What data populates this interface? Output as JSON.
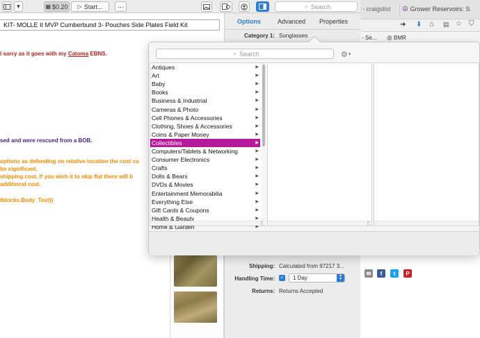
{
  "toolbar": {
    "price": "$0.20",
    "start_label": "Start...",
    "more": "···",
    "search_placeholder": "Search"
  },
  "browser": {
    "tab_partial": "- craigslist",
    "tab2": "Grower Reservoirs: S",
    "addr_partial": "- Se...",
    "bookmark": "BMR"
  },
  "listing": {
    "title": "KIT- MOLLE II MVP Cumberbund 3- Pouches Side Plates Field Kit",
    "lines": {
      "l1a": "l sorry as it goes with my ",
      "l1b": "Catoma",
      "l1c": " EBNS.",
      "l2": "sed and were rescued from a BOB.",
      "l3": "options as defending on relative location the cost ca",
      "l4": " be significant.",
      "l5": " shipping cost.  If you wish it to skip flat there will b",
      "l6": "additional cost.",
      "l7": "tblocks.Body_Text}}"
    }
  },
  "panel": {
    "tabs": [
      "Options",
      "Advanced",
      "Properties"
    ],
    "active_tab": "Options",
    "category_label": "Category 1:",
    "category_value": "Sunglasses",
    "shipping_label": "Shipping:",
    "shipping_value": "Calculated from 97217 3...",
    "handling_label": "Handling Time:",
    "handling_value": "1 Day",
    "returns_label": "Returns:",
    "returns_value": "Returns Accepted"
  },
  "popover": {
    "search_placeholder": "Search",
    "selected": "Collectibles",
    "categories": [
      "Antiques",
      "Art",
      "Baby",
      "Books",
      "Business & Industrial",
      "Cameras & Photo",
      "Cell Phones & Accessories",
      "Clothing, Shoes & Accessories",
      "Coins & Paper Money",
      "Collectibles",
      "Computers/Tablets & Networking",
      "Consumer Electronics",
      "Crafts",
      "Dolls & Bears",
      "DVDs & Movies",
      "Entertainment Memorabilia",
      "Everything Else",
      "Gift Cards & Coupons",
      "Health & Beauty",
      "Home & Garden"
    ]
  },
  "social": {
    "facebook": "f",
    "twitter": "t",
    "pinterest": "P"
  },
  "colors": {
    "accent_blue": "#2b7bd6",
    "selection_magenta": "#b51a9a",
    "text_red": "#b22222",
    "text_purple": "#4b1f7a",
    "text_orange": "#f28c00"
  }
}
